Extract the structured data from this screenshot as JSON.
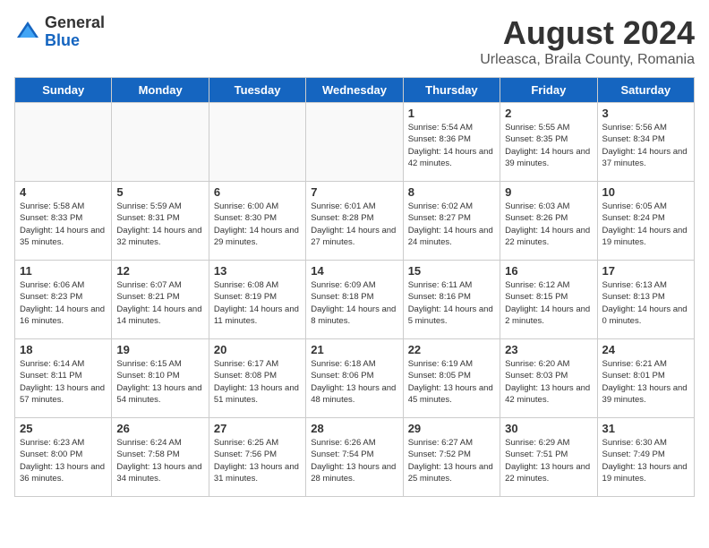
{
  "header": {
    "logo_general": "General",
    "logo_blue": "Blue",
    "month_year": "August 2024",
    "location": "Urleasca, Braila County, Romania"
  },
  "days_of_week": [
    "Sunday",
    "Monday",
    "Tuesday",
    "Wednesday",
    "Thursday",
    "Friday",
    "Saturday"
  ],
  "weeks": [
    [
      {
        "day": "",
        "info": ""
      },
      {
        "day": "",
        "info": ""
      },
      {
        "day": "",
        "info": ""
      },
      {
        "day": "",
        "info": ""
      },
      {
        "day": "1",
        "info": "Sunrise: 5:54 AM\nSunset: 8:36 PM\nDaylight: 14 hours\nand 42 minutes."
      },
      {
        "day": "2",
        "info": "Sunrise: 5:55 AM\nSunset: 8:35 PM\nDaylight: 14 hours\nand 39 minutes."
      },
      {
        "day": "3",
        "info": "Sunrise: 5:56 AM\nSunset: 8:34 PM\nDaylight: 14 hours\nand 37 minutes."
      }
    ],
    [
      {
        "day": "4",
        "info": "Sunrise: 5:58 AM\nSunset: 8:33 PM\nDaylight: 14 hours\nand 35 minutes."
      },
      {
        "day": "5",
        "info": "Sunrise: 5:59 AM\nSunset: 8:31 PM\nDaylight: 14 hours\nand 32 minutes."
      },
      {
        "day": "6",
        "info": "Sunrise: 6:00 AM\nSunset: 8:30 PM\nDaylight: 14 hours\nand 29 minutes."
      },
      {
        "day": "7",
        "info": "Sunrise: 6:01 AM\nSunset: 8:28 PM\nDaylight: 14 hours\nand 27 minutes."
      },
      {
        "day": "8",
        "info": "Sunrise: 6:02 AM\nSunset: 8:27 PM\nDaylight: 14 hours\nand 24 minutes."
      },
      {
        "day": "9",
        "info": "Sunrise: 6:03 AM\nSunset: 8:26 PM\nDaylight: 14 hours\nand 22 minutes."
      },
      {
        "day": "10",
        "info": "Sunrise: 6:05 AM\nSunset: 8:24 PM\nDaylight: 14 hours\nand 19 minutes."
      }
    ],
    [
      {
        "day": "11",
        "info": "Sunrise: 6:06 AM\nSunset: 8:23 PM\nDaylight: 14 hours\nand 16 minutes."
      },
      {
        "day": "12",
        "info": "Sunrise: 6:07 AM\nSunset: 8:21 PM\nDaylight: 14 hours\nand 14 minutes."
      },
      {
        "day": "13",
        "info": "Sunrise: 6:08 AM\nSunset: 8:19 PM\nDaylight: 14 hours\nand 11 minutes."
      },
      {
        "day": "14",
        "info": "Sunrise: 6:09 AM\nSunset: 8:18 PM\nDaylight: 14 hours\nand 8 minutes."
      },
      {
        "day": "15",
        "info": "Sunrise: 6:11 AM\nSunset: 8:16 PM\nDaylight: 14 hours\nand 5 minutes."
      },
      {
        "day": "16",
        "info": "Sunrise: 6:12 AM\nSunset: 8:15 PM\nDaylight: 14 hours\nand 2 minutes."
      },
      {
        "day": "17",
        "info": "Sunrise: 6:13 AM\nSunset: 8:13 PM\nDaylight: 14 hours\nand 0 minutes."
      }
    ],
    [
      {
        "day": "18",
        "info": "Sunrise: 6:14 AM\nSunset: 8:11 PM\nDaylight: 13 hours\nand 57 minutes."
      },
      {
        "day": "19",
        "info": "Sunrise: 6:15 AM\nSunset: 8:10 PM\nDaylight: 13 hours\nand 54 minutes."
      },
      {
        "day": "20",
        "info": "Sunrise: 6:17 AM\nSunset: 8:08 PM\nDaylight: 13 hours\nand 51 minutes."
      },
      {
        "day": "21",
        "info": "Sunrise: 6:18 AM\nSunset: 8:06 PM\nDaylight: 13 hours\nand 48 minutes."
      },
      {
        "day": "22",
        "info": "Sunrise: 6:19 AM\nSunset: 8:05 PM\nDaylight: 13 hours\nand 45 minutes."
      },
      {
        "day": "23",
        "info": "Sunrise: 6:20 AM\nSunset: 8:03 PM\nDaylight: 13 hours\nand 42 minutes."
      },
      {
        "day": "24",
        "info": "Sunrise: 6:21 AM\nSunset: 8:01 PM\nDaylight: 13 hours\nand 39 minutes."
      }
    ],
    [
      {
        "day": "25",
        "info": "Sunrise: 6:23 AM\nSunset: 8:00 PM\nDaylight: 13 hours\nand 36 minutes."
      },
      {
        "day": "26",
        "info": "Sunrise: 6:24 AM\nSunset: 7:58 PM\nDaylight: 13 hours\nand 34 minutes."
      },
      {
        "day": "27",
        "info": "Sunrise: 6:25 AM\nSunset: 7:56 PM\nDaylight: 13 hours\nand 31 minutes."
      },
      {
        "day": "28",
        "info": "Sunrise: 6:26 AM\nSunset: 7:54 PM\nDaylight: 13 hours\nand 28 minutes."
      },
      {
        "day": "29",
        "info": "Sunrise: 6:27 AM\nSunset: 7:52 PM\nDaylight: 13 hours\nand 25 minutes."
      },
      {
        "day": "30",
        "info": "Sunrise: 6:29 AM\nSunset: 7:51 PM\nDaylight: 13 hours\nand 22 minutes."
      },
      {
        "day": "31",
        "info": "Sunrise: 6:30 AM\nSunset: 7:49 PM\nDaylight: 13 hours\nand 19 minutes."
      }
    ]
  ]
}
